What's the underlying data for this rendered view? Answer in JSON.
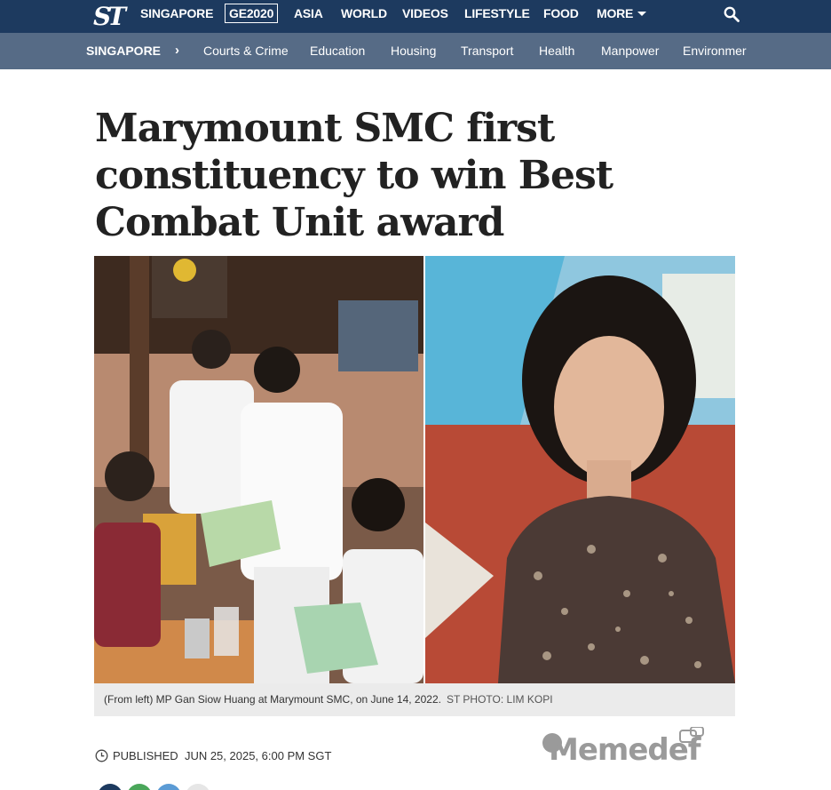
{
  "brand": {
    "logo_text": "ST"
  },
  "topnav": {
    "items": [
      {
        "label": "SINGAPORE"
      },
      {
        "label": "GE2020"
      },
      {
        "label": "ASIA"
      },
      {
        "label": "WORLD"
      },
      {
        "label": "VIDEOS"
      },
      {
        "label": "LIFESTYLE"
      },
      {
        "label": "FOOD"
      },
      {
        "label": "MORE"
      }
    ],
    "search_icon": "search-icon"
  },
  "subnav": {
    "section": "SINGAPORE",
    "items": [
      {
        "label": "Courts & Crime"
      },
      {
        "label": "Education"
      },
      {
        "label": "Housing"
      },
      {
        "label": "Transport"
      },
      {
        "label": "Health"
      },
      {
        "label": "Manpower"
      },
      {
        "label": "Environmer"
      }
    ]
  },
  "article": {
    "headline": "Marymount SMC first constituency to win Best Combat Unit award",
    "caption": "(From left) MP Gan Siow Huang at Marymount SMC, on June 14, 2022.",
    "credit": "ST PHOTO: LIM KOPI",
    "published_label": "PUBLISHED",
    "published_date": "JUN 25, 2025, 6:00 PM SGT"
  },
  "watermark": {
    "text": "Memedef"
  },
  "colors": {
    "topnav_bg": "#1d3a5f",
    "subnav_bg": "#566b86",
    "caption_bg": "#ebebeb"
  }
}
